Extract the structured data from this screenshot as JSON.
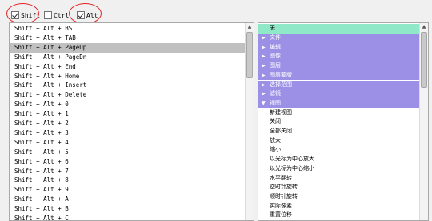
{
  "modifiers": [
    {
      "label": "Shift",
      "checked": true
    },
    {
      "label": "Ctrl",
      "checked": false
    },
    {
      "label": "Alt",
      "checked": true
    }
  ],
  "shortcut_list": {
    "selected_index": 2,
    "items": [
      "Shift + Alt + BS",
      "Shift + Alt + TAB",
      "Shift + Alt + PageUp",
      "Shift + Alt + PageDn",
      "Shift + Alt + End",
      "Shift + Alt + Home",
      "Shift + Alt + Insert",
      "Shift + Alt + Delete",
      "Shift + Alt + 0",
      "Shift + Alt + 1",
      "Shift + Alt + 2",
      "Shift + Alt + 3",
      "Shift + Alt + 4",
      "Shift + Alt + 5",
      "Shift + Alt + 6",
      "Shift + Alt + 7",
      "Shift + Alt + 8",
      "Shift + Alt + 9",
      "Shift + Alt + A",
      "Shift + Alt + B",
      "Shift + Alt + C"
    ]
  },
  "command_tree": {
    "none_label": "无",
    "categories": [
      {
        "label": "文件",
        "expanded": false
      },
      {
        "label": "编辑",
        "expanded": false
      },
      {
        "label": "图像",
        "expanded": false
      },
      {
        "label": "图层",
        "expanded": false
      },
      {
        "label": "图层蒙版",
        "expanded": false
      },
      {
        "label": "选择范围",
        "expanded": false
      },
      {
        "label": "滤镜",
        "expanded": false
      },
      {
        "label": "视图",
        "expanded": true
      }
    ],
    "view_items": [
      "新建视图",
      "关闭",
      "全部关闭",
      "放大",
      "缩小",
      "以光标为中心放大",
      "以光标为中心缩小",
      "水平翻转",
      "逆时针旋转",
      "顺时针旋转",
      "实际像素",
      "重置位移"
    ]
  },
  "colors": {
    "none_row": "#8fe8c8",
    "category_row": "#9b90e6",
    "selected_row": "#c0c0c0",
    "annotation_circle": "#e02424"
  }
}
